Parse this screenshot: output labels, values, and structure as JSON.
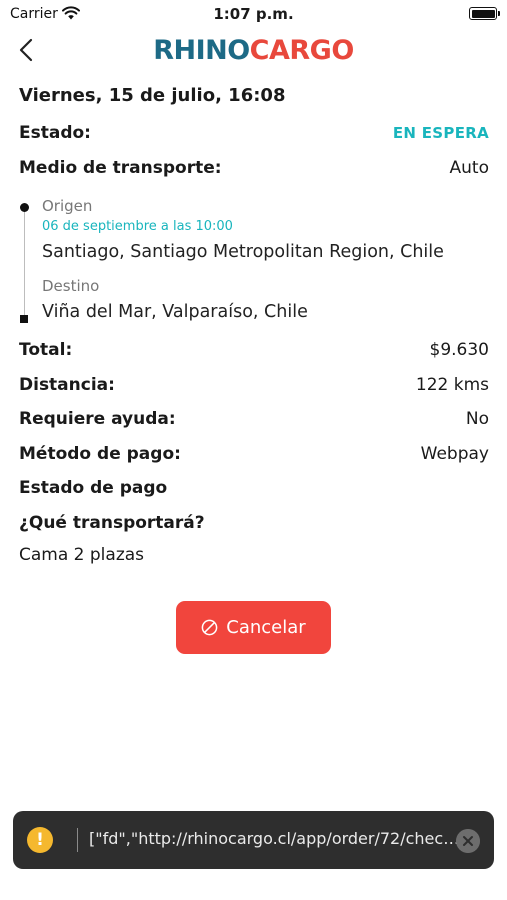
{
  "status_bar": {
    "carrier": "Carrier",
    "time": "1:07 p.m.",
    "icons": [
      "wifi-icon",
      "battery-icon"
    ]
  },
  "nav": {
    "back_icon": "chevron-left-icon",
    "logo_part1": "RHINO",
    "logo_part2": "CARGO"
  },
  "order": {
    "title": "Viernes, 15 de julio, 16:08",
    "estado_label": "Estado:",
    "estado_value": "EN ESPERA",
    "transporte_label": "Medio de transporte:",
    "transporte_value": "Auto",
    "origen_label": "Origen",
    "origen_date": "06 de septiembre a las 10:00",
    "origen_address": "Santiago, Santiago Metropolitan Region, Chile",
    "destino_label": "Destino",
    "destino_address": "Viña del Mar, Valparaíso, Chile",
    "total_label": "Total:",
    "total_value": "$9.630",
    "distancia_label": "Distancia:",
    "distancia_value": "122 kms",
    "ayuda_label": "Requiere ayuda:",
    "ayuda_value": "No",
    "metodo_label": "Método de pago:",
    "metodo_value": "Webpay",
    "estado_pago_label": "Estado de pago",
    "transportara_label": "¿Qué transportará?",
    "transportara_value": "Cama 2 plazas"
  },
  "cancel_button": {
    "label": "Cancelar",
    "icon": "ban-icon"
  },
  "toast": {
    "icon_text": "!",
    "message": "[\"fd\",\"http://rhinocargo.cl/app/order/72/check...",
    "close_icon": "close-icon"
  },
  "colors": {
    "brand_blue": "#1d6a86",
    "brand_red": "#e8483c",
    "status_teal": "#19b5bd",
    "cancel_red": "#f1453d",
    "toast_bg": "#2e2e2e",
    "warn_yellow": "#f5b82e"
  }
}
